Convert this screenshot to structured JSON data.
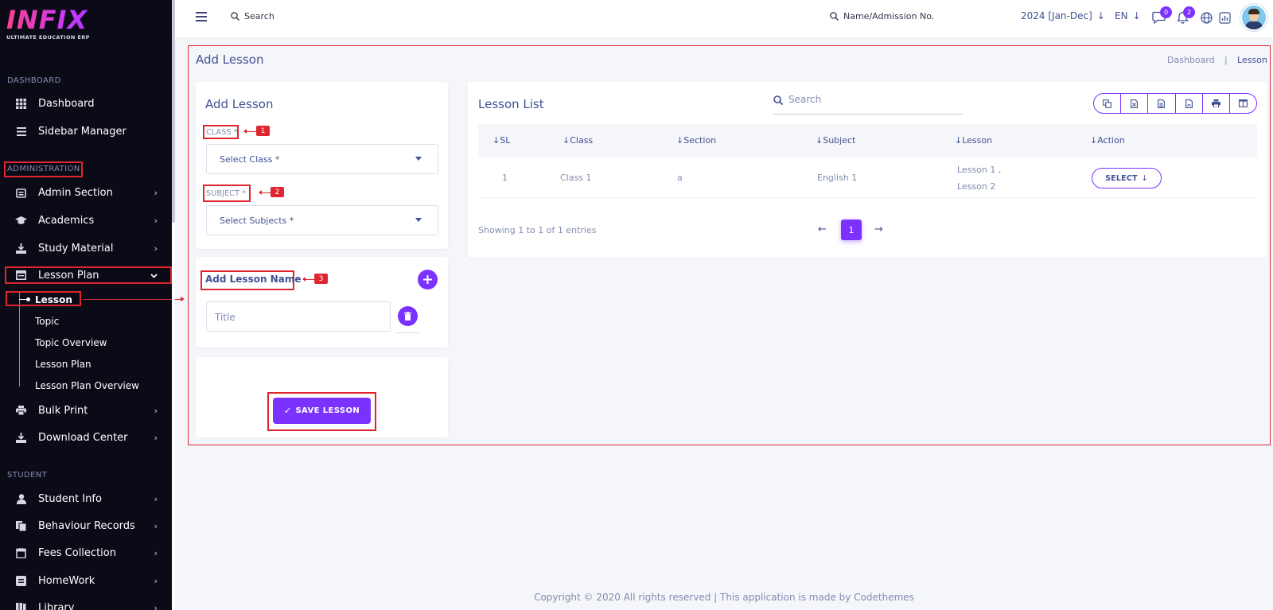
{
  "app": {
    "logo_text": "INFIX",
    "logo_tagline": "ULTIMATE EDUCATION ERP"
  },
  "sidebar": {
    "sections": {
      "dashboard": "DASHBOARD",
      "administration": "ADMINISTRATION",
      "student": "STUDENT"
    },
    "top_items": [
      {
        "label": "Dashboard",
        "icon": "grid-icon"
      },
      {
        "label": "Sidebar Manager",
        "icon": "menu-icon"
      }
    ],
    "admin_items": [
      {
        "label": "Admin Section",
        "icon": "admin-icon"
      },
      {
        "label": "Academics",
        "icon": "graduation-cap-icon"
      },
      {
        "label": "Study Material",
        "icon": "download-icon"
      },
      {
        "label": "Lesson Plan",
        "icon": "calendar-icon"
      }
    ],
    "lesson_plan_sub": [
      "Lesson",
      "Topic",
      "Topic Overview",
      "Lesson Plan",
      "Lesson Plan Overview"
    ],
    "after_items": [
      {
        "label": "Bulk Print",
        "icon": "printer-icon"
      },
      {
        "label": "Download Center",
        "icon": "download-icon"
      }
    ],
    "student_items": [
      {
        "label": "Student Info",
        "icon": "user-icon"
      },
      {
        "label": "Behaviour Records",
        "icon": "records-icon"
      },
      {
        "label": "Fees Collection",
        "icon": "fees-icon"
      },
      {
        "label": "HomeWork",
        "icon": "homework-icon"
      },
      {
        "label": "Library",
        "icon": "library-icon"
      }
    ]
  },
  "topbar": {
    "search_label": "Search",
    "student_search_label": "Name/Admission No.",
    "session": "2024 [Jan-Dec]",
    "language": "EN",
    "messages_count": "0",
    "notifications_count": "2"
  },
  "page": {
    "title": "Add Lesson",
    "breadcrumb": [
      "Dashboard",
      "|",
      "Lesson"
    ]
  },
  "form": {
    "title": "Add Lesson",
    "class_label": "CLASS *",
    "class_placeholder": "Select Class *",
    "subject_label": "SUBJECT *",
    "subject_placeholder": "Select Subjects *",
    "lesson_name_title": "Add Lesson Name",
    "title_placeholder": "Title",
    "save_label": "SAVE LESSON"
  },
  "annotations": [
    "1",
    "2",
    "3"
  ],
  "lesson_list": {
    "title": "Lesson List",
    "search_placeholder": "Search",
    "columns": [
      "SL",
      "Class",
      "Section",
      "Subject",
      "Lesson",
      "Action"
    ],
    "rows": [
      {
        "sl": "1",
        "class": "Class 1",
        "section": "a",
        "subject": "English 1",
        "lesson_1": "Lesson 1 ,",
        "lesson_2": "Lesson 2",
        "action": "SELECT"
      }
    ],
    "info": "Showing 1 to 1 of 1 entries",
    "current_page": "1",
    "tools": [
      "copy-icon",
      "excel-icon",
      "csv-icon",
      "pdf-icon",
      "print-icon",
      "columns-icon"
    ]
  },
  "footer": "Copyright © 2020 All rights reserved | This application is made by Codethemes",
  "colors": {
    "accent": "#7c32ff",
    "sidebar_bg": "#0b0b18",
    "annotation": "#e0252f",
    "text": "#415094"
  }
}
